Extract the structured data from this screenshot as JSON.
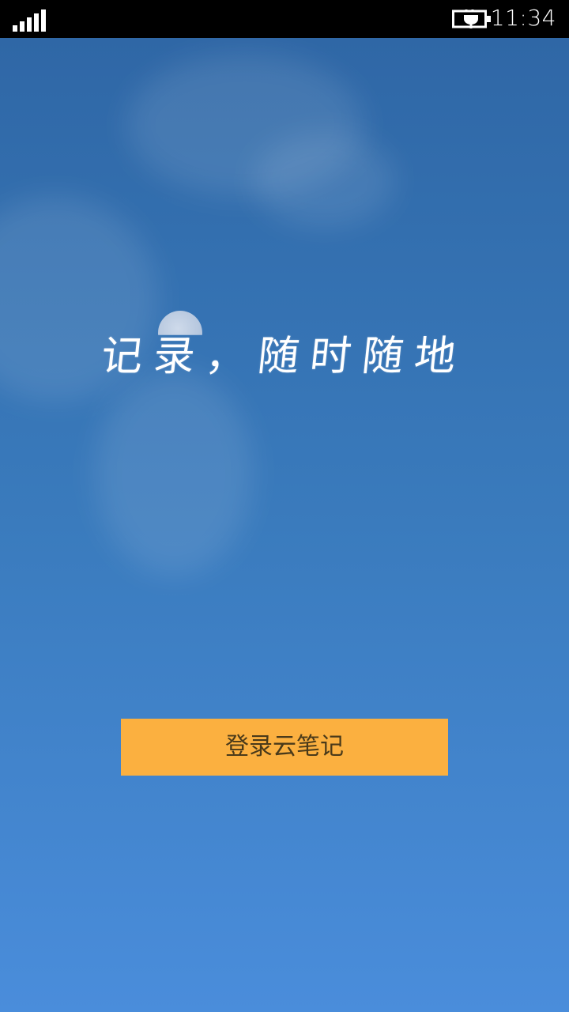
{
  "status_bar": {
    "time": "11:34",
    "signal_icon": "signal-bars-icon",
    "battery_icon": "battery-charging-icon"
  },
  "main": {
    "slogan": "记录，随时随地",
    "login_button_label": "登录云笔记"
  },
  "colors": {
    "accent_button": "#fbb040",
    "sky_top": "#2f67a6",
    "sky_bottom": "#4a8ddb"
  }
}
